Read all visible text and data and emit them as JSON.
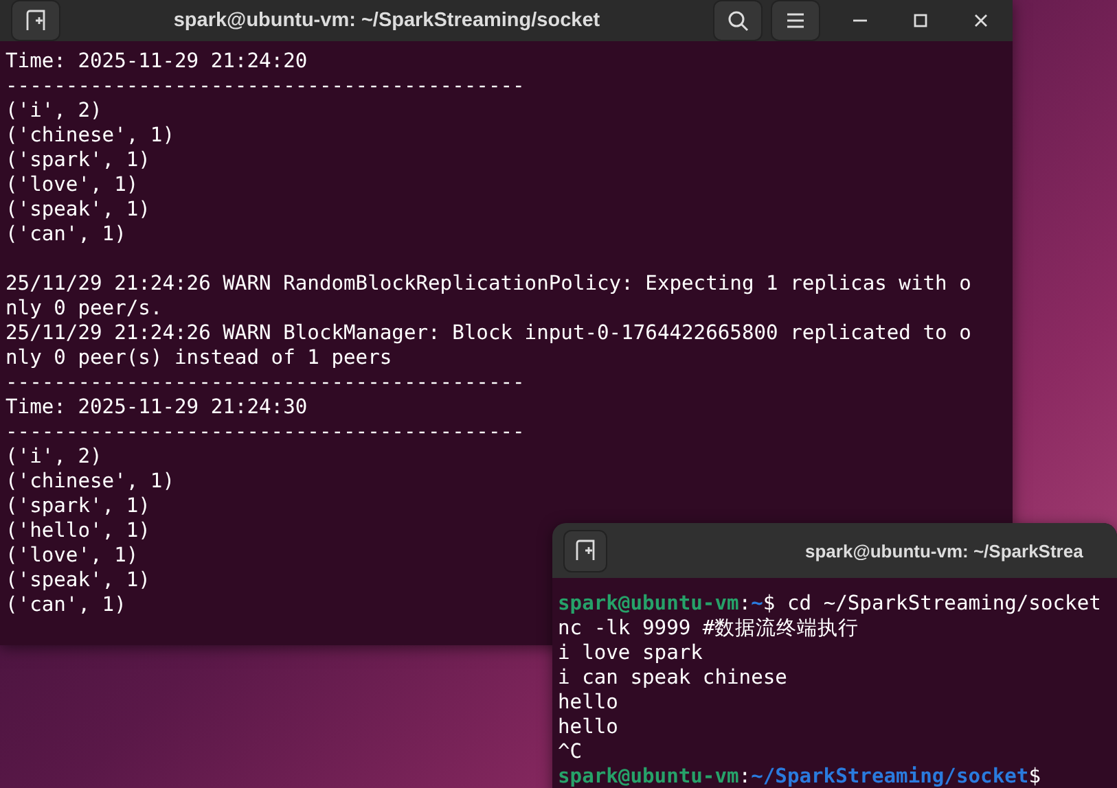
{
  "windows": [
    {
      "title": "spark@ubuntu-vm: ~/SparkStreaming/socket",
      "controls": true,
      "lines": [
        {
          "kind": "output",
          "text": "Time: 2025-11-29 21:24:20"
        },
        {
          "kind": "output",
          "text": "-------------------------------------------"
        },
        {
          "kind": "output",
          "text": "('i', 2)"
        },
        {
          "kind": "output",
          "text": "('chinese', 1)"
        },
        {
          "kind": "output",
          "text": "('spark', 1)"
        },
        {
          "kind": "output",
          "text": "('love', 1)"
        },
        {
          "kind": "output",
          "text": "('speak', 1)"
        },
        {
          "kind": "output",
          "text": "('can', 1)"
        },
        {
          "kind": "blank"
        },
        {
          "kind": "output",
          "text": "25/11/29 21:24:26 WARN RandomBlockReplicationPolicy: Expecting 1 replicas with o"
        },
        {
          "kind": "output",
          "text": "nly 0 peer/s."
        },
        {
          "kind": "output",
          "text": "25/11/29 21:24:26 WARN BlockManager: Block input-0-1764422665800 replicated to o"
        },
        {
          "kind": "output",
          "text": "nly 0 peer(s) instead of 1 peers"
        },
        {
          "kind": "output",
          "text": "-------------------------------------------"
        },
        {
          "kind": "output",
          "text": "Time: 2025-11-29 21:24:30"
        },
        {
          "kind": "output",
          "text": "-------------------------------------------"
        },
        {
          "kind": "output",
          "text": "('i', 2)"
        },
        {
          "kind": "output",
          "text": "('chinese', 1)"
        },
        {
          "kind": "output",
          "text": "('spark', 1)"
        },
        {
          "kind": "output",
          "text": "('hello', 1)"
        },
        {
          "kind": "output",
          "text": "('love', 1)"
        },
        {
          "kind": "output",
          "text": "('speak', 1)"
        },
        {
          "kind": "output",
          "text": "('can', 1)"
        }
      ]
    },
    {
      "title": "spark@ubuntu-vm: ~/SparkStrea",
      "controls": false,
      "lines": [
        {
          "kind": "prompt",
          "user": "spark@ubuntu-vm",
          "sep": ":",
          "path": "~",
          "command": "$ cd ~/SparkStreaming/socket"
        },
        {
          "kind": "output",
          "text": "nc -lk 9999 #数据流终端执行"
        },
        {
          "kind": "output",
          "text": "i love spark"
        },
        {
          "kind": "output",
          "text": "i can speak chinese"
        },
        {
          "kind": "output",
          "text": "hello"
        },
        {
          "kind": "output",
          "text": "hello"
        },
        {
          "kind": "output",
          "text": "^C"
        },
        {
          "kind": "prompt",
          "user": "spark@ubuntu-vm",
          "sep": ":",
          "path": "~/SparkStreaming/socket",
          "command": "$"
        }
      ]
    }
  ]
}
